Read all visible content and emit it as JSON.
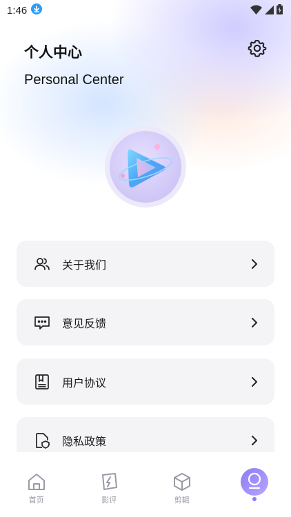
{
  "status_bar": {
    "time": "1:46",
    "icons": [
      "download-icon",
      "wifi-icon",
      "signal-icon",
      "battery-icon"
    ]
  },
  "header": {
    "title_zh": "个人中心",
    "title_en": "Personal Center",
    "settings_icon": "gear-icon"
  },
  "menu": {
    "items": [
      {
        "label": "关于我们",
        "icon": "users-icon"
      },
      {
        "label": "意见反馈",
        "icon": "chat-icon"
      },
      {
        "label": "用户协议",
        "icon": "agreement-icon"
      },
      {
        "label": "隐私政策",
        "icon": "privacy-icon"
      }
    ]
  },
  "bottom_nav": {
    "items": [
      {
        "label": "首页",
        "icon": "home-icon"
      },
      {
        "label": "影评",
        "icon": "review-icon"
      },
      {
        "label": "剪辑",
        "icon": "box-icon"
      },
      {
        "label": "",
        "icon": "profile-icon",
        "active": true
      }
    ]
  },
  "colors": {
    "accent": "#8a7cf6",
    "card_bg": "#f4f4f7",
    "nav_label": "#9a9aa6"
  }
}
